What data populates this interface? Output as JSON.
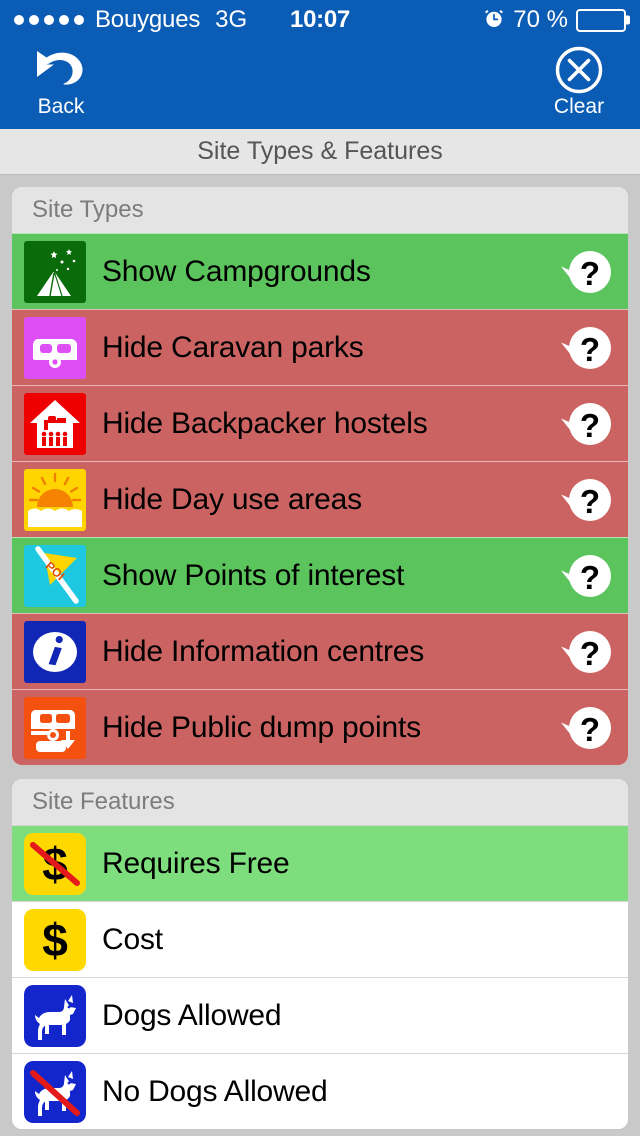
{
  "status_bar": {
    "signal_dots": 5,
    "carrier": "Bouygues",
    "network": "3G",
    "time": "10:07",
    "alarm_icon": "alarm-clock-icon",
    "battery_percent": "70 %",
    "battery_level": 70
  },
  "nav_bar": {
    "back_label": "Back",
    "back_icon": "undo-arrow-icon",
    "clear_label": "Clear",
    "clear_icon": "circle-x-icon"
  },
  "title_bar": {
    "title": "Site Types & Features"
  },
  "colors": {
    "nav_blue": "#0b5cb5",
    "row_on_green": "#5cc45c",
    "row_off_red": "#cc6363",
    "feature_on_green": "#7ede7e",
    "page_background": "#c9c9c9",
    "section_header_gray": "#e4e4e4",
    "title_bar_gray": "#e6e6e6"
  },
  "sections": [
    {
      "header": "Site Types",
      "rows": [
        {
          "label": "Show Campgrounds",
          "state": "on",
          "icon": "campground-icon",
          "help": "?"
        },
        {
          "label": "Hide Caravan parks",
          "state": "off",
          "icon": "caravan-icon",
          "help": "?"
        },
        {
          "label": "Hide Backpacker hostels",
          "state": "off",
          "icon": "backpacker-hostel-icon",
          "help": "?"
        },
        {
          "label": "Hide Day use areas",
          "state": "off",
          "icon": "day-use-area-icon",
          "help": "?"
        },
        {
          "label": "Show Points of interest",
          "state": "on",
          "icon": "point-of-interest-icon",
          "help": "?"
        },
        {
          "label": "Hide Information centres",
          "state": "off",
          "icon": "information-icon",
          "help": "?"
        },
        {
          "label": "Hide Public dump points",
          "state": "off",
          "icon": "dump-point-icon",
          "help": "?"
        }
      ]
    },
    {
      "header": "Site Features",
      "rows": [
        {
          "label": "Requires Free",
          "state": "on",
          "icon": "free-no-cost-icon"
        },
        {
          "label": "Cost",
          "state": "neutral",
          "icon": "cost-dollar-icon"
        },
        {
          "label": "Dogs Allowed",
          "state": "neutral",
          "icon": "dogs-allowed-icon"
        },
        {
          "label": "No Dogs Allowed",
          "state": "neutral",
          "icon": "no-dogs-allowed-icon"
        }
      ]
    }
  ]
}
